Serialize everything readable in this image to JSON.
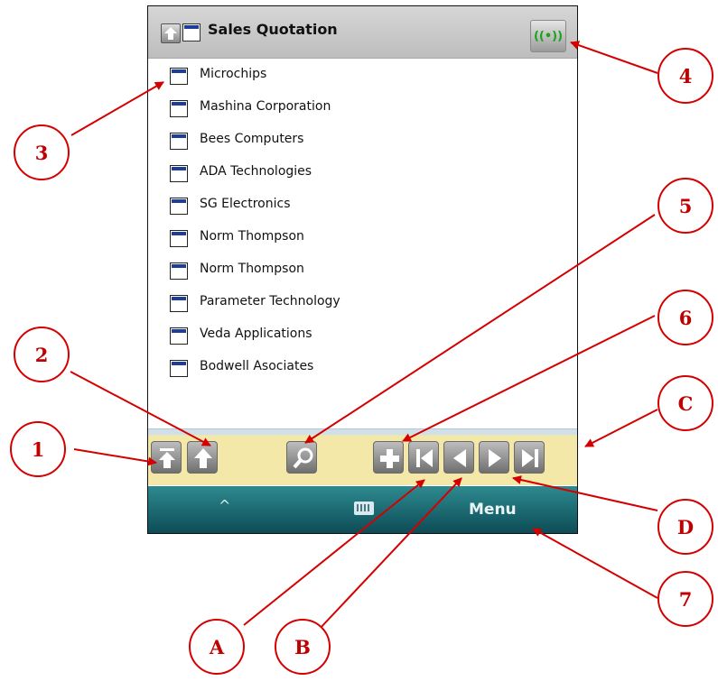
{
  "window": {
    "title": "Sales Quotation",
    "signal_glyph": "((•))"
  },
  "list": {
    "items": [
      {
        "label": "Microchips"
      },
      {
        "label": "Mashina Corporation"
      },
      {
        "label": "Bees Computers"
      },
      {
        "label": "ADA Technologies"
      },
      {
        "label": "SG Electronics"
      },
      {
        "label": "Norm Thompson"
      },
      {
        "label": "Norm Thompson"
      },
      {
        "label": "Parameter Technology"
      },
      {
        "label": "Veda Applications"
      },
      {
        "label": "Bodwell Asociates"
      }
    ]
  },
  "softkeys": {
    "left": "^",
    "right": "Menu"
  },
  "callouts": {
    "c1": "1",
    "c2": "2",
    "c3": "3",
    "c4": "4",
    "c5": "5",
    "c6": "6",
    "c7": "7",
    "cA": "A",
    "cB": "B",
    "cC": "C",
    "cD": "D"
  },
  "colors": {
    "callout_red": "#d40000",
    "title_blue": "#1e3c9a",
    "toolbar_yellow": "#f3e8a8",
    "softbar_teal": "#2d8a8f"
  }
}
